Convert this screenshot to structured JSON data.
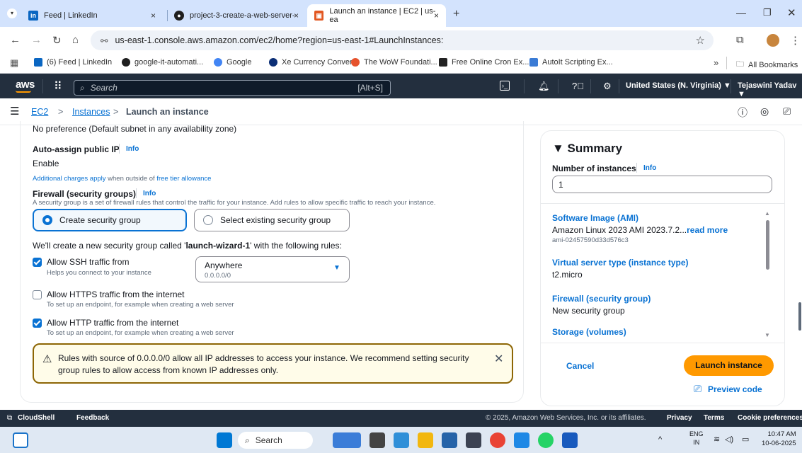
{
  "browser": {
    "tabs": [
      {
        "title": "Feed | LinkedIn",
        "close": "×"
      },
      {
        "title": "project-3-create-a-web-server-",
        "close": "×"
      },
      {
        "title": "Launch an instance | EC2 | us-ea",
        "close": "×"
      }
    ],
    "new_tab": "+",
    "url": "us-east-1.console.aws.amazon.com/ec2/home?region=us-east-1#LaunchInstances:",
    "bookmarks": [
      "(6) Feed | LinkedIn",
      "google-it-automati...",
      "Google",
      "Xe Currency Conver...",
      "The WoW Foundati...",
      "Free Online Cron Ex...",
      "AutoIt Scripting Ex..."
    ],
    "bookmarks_more": "»",
    "all_bookmarks": "All Bookmarks"
  },
  "aws": {
    "logo": "aws",
    "search_placeholder": "Search",
    "search_shortcut": "[Alt+S]",
    "region": "United States (N. Virginia) ▼",
    "user": "Tejaswini Yadav ▼"
  },
  "breadcrumb": {
    "root": "EC2",
    "sep": ">",
    "instances": "Instances",
    "current": "Launch an instance"
  },
  "form": {
    "subnet_text": "No preference (Default subnet in any availability zone)",
    "auto_assign_label": "Auto-assign public IP",
    "info": "Info",
    "auto_assign_value": "Enable",
    "charges_prefix": "Additional charges apply",
    "charges_mid": " when outside of ",
    "charges_link": "free tier allowance",
    "firewall_label": "Firewall (security groups)",
    "firewall_desc": "A security group is a set of firewall rules that control the traffic for your instance. Add rules to allow specific traffic to reach your instance.",
    "create_sg": "Create security group",
    "select_sg": "Select existing security group",
    "create_note_pre": "We'll create a new security group called '",
    "create_note_name": "launch-wizard-1",
    "create_note_post": "' with the following rules:",
    "ssh_label": "Allow SSH traffic from",
    "ssh_help": "Helps you connect to your instance",
    "ssh_source": "Anywhere",
    "ssh_cidr": "0.0.0.0/0",
    "https_label": "Allow HTTPS traffic from the internet",
    "https_help": "To set up an endpoint, for example when creating a web server",
    "http_label": "Allow HTTP traffic from the internet",
    "http_help": "To set up an endpoint, for example when creating a web server",
    "warning_line1": "Rules with source of 0.0.0.0/0 allow all IP addresses to access your instance. We recommend setting security",
    "warning_line2": "group rules to allow access from known IP addresses only.",
    "ssh_checked": true,
    "https_checked": false,
    "http_checked": true
  },
  "summary": {
    "title": "▼ Summary",
    "num_label": "Number of instances",
    "info": "Info",
    "num_value": "1",
    "ami_label": "Software Image (AMI)",
    "ami_value": "Amazon Linux 2023 AMI 2023.7.2...",
    "read_more": "read more",
    "ami_id": "ami-02457590d33d576c3",
    "type_label": "Virtual server type (instance type)",
    "type_value": "t2.micro",
    "fw_label": "Firewall (security group)",
    "fw_value": "New security group",
    "storage_label": "Storage (volumes)",
    "cancel": "Cancel",
    "launch": "Launch instance",
    "preview": "Preview code"
  },
  "footer": {
    "cloudshell": "CloudShell",
    "feedback": "Feedback",
    "copyright": "© 2025, Amazon Web Services, Inc. or its affiliates.",
    "privacy": "Privacy",
    "terms": "Terms",
    "cookies": "Cookie preferences"
  },
  "taskbar": {
    "search": "Search",
    "lang_top": "ENG",
    "lang_bottom": "IN",
    "time": "10:47 AM",
    "date": "10-06-2025"
  },
  "colors": {
    "aws_nav": "#232f3e",
    "link": "#0972d3",
    "primary": "#ff9900",
    "warning_border": "#8d6605",
    "warning_bg": "#fffce9"
  }
}
